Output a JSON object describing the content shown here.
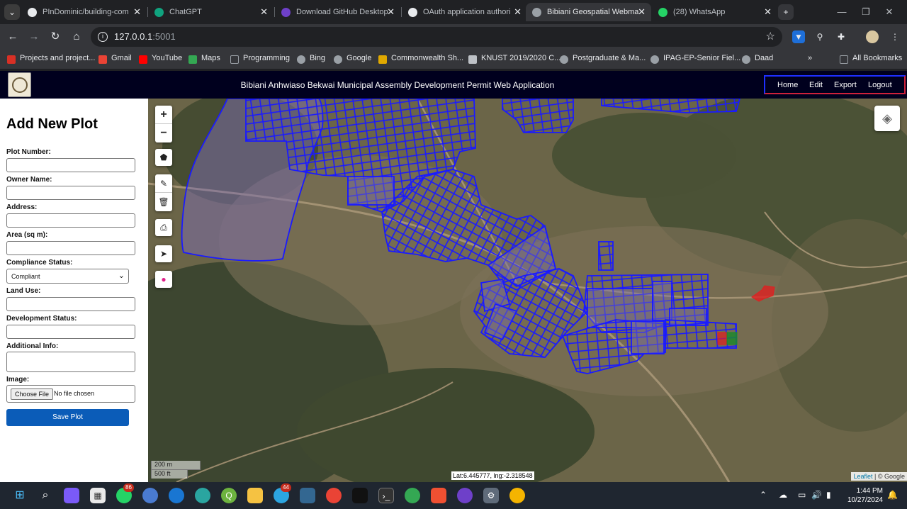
{
  "browser": {
    "tabs": [
      {
        "title": "PInDominic/building-com",
        "icon": "github-icon",
        "active": false
      },
      {
        "title": "ChatGPT",
        "icon": "chatgpt-icon",
        "active": false
      },
      {
        "title": "Download GitHub Desktop",
        "icon": "github-desktop-icon",
        "active": false
      },
      {
        "title": "OAuth application authori",
        "icon": "github-icon",
        "active": false
      },
      {
        "title": "Bibiani Geospatial Webma",
        "icon": "globe-icon",
        "active": true
      },
      {
        "title": "(28) WhatsApp",
        "icon": "whatsapp-icon",
        "active": false
      }
    ],
    "url_host": "127.0.0.1",
    "url_port": ":5001",
    "bookmarks": [
      {
        "label": "Projects and project...",
        "color": "#d93025"
      },
      {
        "label": "Gmail",
        "color": "#ea4335"
      },
      {
        "label": "YouTube",
        "color": "#ff0000"
      },
      {
        "label": "Maps",
        "color": "#34a853"
      },
      {
        "label": "Programming",
        "color": "#9aa0a6"
      },
      {
        "label": "Bing",
        "color": "#9aa0a6"
      },
      {
        "label": "Google",
        "color": "#9aa0a6"
      },
      {
        "label": "Commonwealth Sh...",
        "color": "#e0a800"
      },
      {
        "label": "KNUST 2019/2020 C...",
        "color": "#bdc1c6"
      },
      {
        "label": "Postgraduate & Ma...",
        "color": "#9aa0a6"
      },
      {
        "label": "IPAG-EP-Senior Fiel...",
        "color": "#9aa0a6"
      },
      {
        "label": "Daad",
        "color": "#9aa0a6"
      }
    ],
    "all_bookmarks": "All Bookmarks"
  },
  "app": {
    "title": "Bibiani Anhwiaso Bekwai Municipal Assembly Development Permit Web Application",
    "nav": [
      "Home",
      "Edit",
      "Export",
      "Logout"
    ]
  },
  "form": {
    "heading": "Add New Plot",
    "plot_number_label": "Plot Number:",
    "owner_name_label": "Owner Name:",
    "address_label": "Address:",
    "area_label": "Area (sq m):",
    "compliance_label": "Compliance Status:",
    "compliance_value": "Compliant",
    "land_use_label": "Land Use:",
    "development_label": "Development Status:",
    "additional_label": "Additional Info:",
    "image_label": "Image:",
    "choose_file": "Choose File",
    "no_file": "No file chosen",
    "save": "Save Plot"
  },
  "map": {
    "scale_metric": "200 m",
    "scale_imperial": "500 ft",
    "coords": "Lat:6.445777, lng:-2.318548",
    "attribution_leaflet": "Leaflet",
    "attribution_rest": " | © Google",
    "parcel_color": "#1a1aff",
    "non_compliant_color": "#e02020",
    "compliant_color": "#1a8a2a"
  },
  "taskbar": {
    "whatsapp_badge": "86",
    "telegram_badge": "44",
    "time": "1:44 PM",
    "date": "10/27/2024"
  }
}
